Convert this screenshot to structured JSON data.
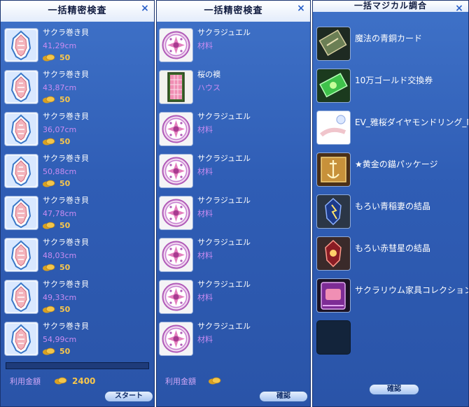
{
  "panel1": {
    "title": "一括精密検査",
    "close": "×",
    "items": [
      {
        "name": "サクラ巻き貝",
        "size": "41,29cm",
        "price": "50"
      },
      {
        "name": "サクラ巻き貝",
        "size": "43,87cm",
        "price": "50"
      },
      {
        "name": "サクラ巻き貝",
        "size": "36,07cm",
        "price": "50"
      },
      {
        "name": "サクラ巻き貝",
        "size": "50,88cm",
        "price": "50"
      },
      {
        "name": "サクラ巻き貝",
        "size": "47,78cm",
        "price": "50"
      },
      {
        "name": "サクラ巻き貝",
        "size": "48,03cm",
        "price": "50"
      },
      {
        "name": "サクラ巻き貝",
        "size": "49,33cm",
        "price": "50"
      },
      {
        "name": "サクラ巻き貝",
        "size": "54,99cm",
        "price": "50"
      }
    ],
    "progress": 0.0,
    "fee_label": "利用金額",
    "total": "2400",
    "start_label": "スタート"
  },
  "panel2": {
    "title": "一括精密検査",
    "close": "×",
    "items": [
      {
        "name": "サクラジュエル",
        "kind": "材料",
        "icon": "sakura-jewel-icon"
      },
      {
        "name": "桜の襖",
        "kind": "ハウス",
        "icon": "sakura-fusuma-icon"
      },
      {
        "name": "サクラジュエル",
        "kind": "材料",
        "icon": "sakura-jewel-icon"
      },
      {
        "name": "サクラジュエル",
        "kind": "材料",
        "icon": "sakura-jewel-icon"
      },
      {
        "name": "サクラジュエル",
        "kind": "材料",
        "icon": "sakura-jewel-icon"
      },
      {
        "name": "サクラジュエル",
        "kind": "材料",
        "icon": "sakura-jewel-icon"
      },
      {
        "name": "サクラジュエル",
        "kind": "材料",
        "icon": "sakura-jewel-icon"
      },
      {
        "name": "サクラジュエル",
        "kind": "材料",
        "icon": "sakura-jewel-icon"
      }
    ],
    "fee_label": "利用金額",
    "confirm_label": "確認"
  },
  "panel3": {
    "title": "一括マジカル調合",
    "close": "×",
    "items": [
      {
        "name": "魔法の青銅カード",
        "icon": "bronze-card-icon"
      },
      {
        "name": "10万ゴールド交換券",
        "icon": "gold-ticket-icon"
      },
      {
        "name": "EV_雅桜ダイヤモンドリング_M",
        "icon": "diamond-ring-icon"
      },
      {
        "name": "★黄金の錨パッケージ",
        "icon": "golden-anchor-package-icon"
      },
      {
        "name": "もろい青稲妻の結晶",
        "icon": "blue-lightning-crystal-icon"
      },
      {
        "name": "もろい赤彗星の結晶",
        "icon": "red-comet-crystal-icon"
      },
      {
        "name": "サクラリウム家具コレクション II",
        "icon": "furniture-collection-icon"
      },
      {
        "name": "",
        "icon": "empty-slot"
      }
    ],
    "confirm_label": "確認"
  }
}
